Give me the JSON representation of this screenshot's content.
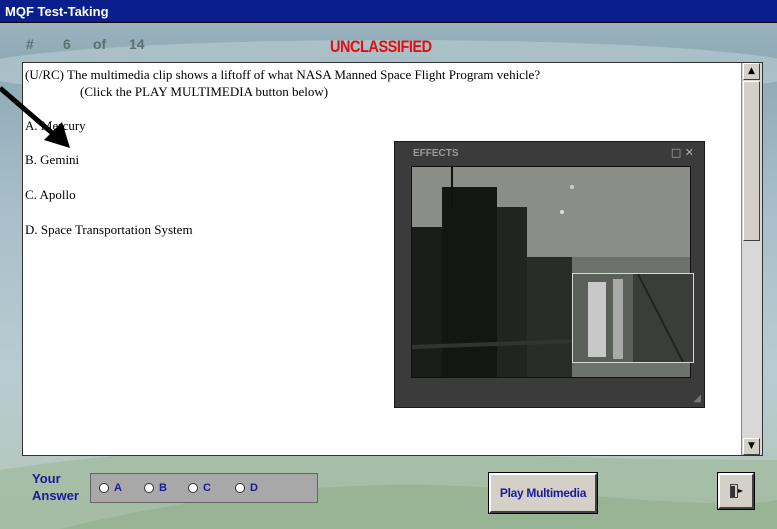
{
  "window": {
    "title": "MQF Test-Taking"
  },
  "question_counter": {
    "hash": "#",
    "current": "6",
    "of": "of",
    "total": "14"
  },
  "classification": "UNCLASSIFIED",
  "question": {
    "line1": "(U/RC)  The multimedia clip shows a liftoff of what NASA Manned Space Flight Program vehicle?",
    "line2": "(Click the PLAY MULTIMEDIA button below)",
    "options": [
      {
        "text": "A.  Mercury"
      },
      {
        "text": "B.  Gemini"
      },
      {
        "text": "C.  Apollo"
      },
      {
        "text": "D.  Space Transportation System"
      }
    ]
  },
  "effects_panel": {
    "title": "EFFECTS",
    "controls": "□ ✕"
  },
  "answer": {
    "label_line1": "Your",
    "label_line2": "Answer",
    "choices": [
      "A",
      "B",
      "C",
      "D"
    ]
  },
  "buttons": {
    "play_multimedia": "Play Multimedia",
    "exit_icon": "exit-door-icon"
  },
  "colors": {
    "titlebar": "#0a1e8c",
    "classification": "#e01010",
    "label": "#1a1a9a"
  }
}
